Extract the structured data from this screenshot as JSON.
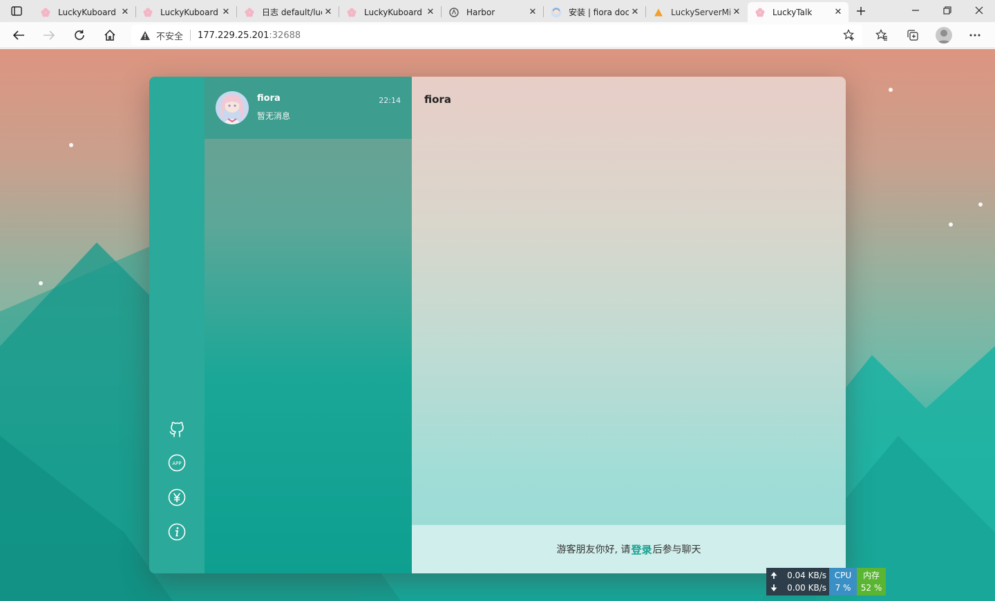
{
  "browser": {
    "tabs": [
      {
        "label": "LuckyKuboard",
        "icon": "sakura-icon"
      },
      {
        "label": "LuckyKuboard",
        "icon": "sakura-icon"
      },
      {
        "label": "日志 default/luc",
        "icon": "sakura-icon"
      },
      {
        "label": "LuckyKuboard",
        "icon": "sakura-icon"
      },
      {
        "label": "Harbor",
        "icon": "harbor-icon"
      },
      {
        "label": "安装 | fiora doc",
        "icon": "anime-avatar-icon"
      },
      {
        "label": "LuckyServerMiy",
        "icon": "warning-triangle-icon"
      },
      {
        "label": "LuckyTalk",
        "icon": "sakura-icon"
      }
    ],
    "active_tab_index": 7,
    "address": {
      "security_label": "不安全",
      "host": "177.229.25.201",
      "port": ":32688"
    }
  },
  "app": {
    "sidebar_icons": [
      "github-icon",
      "app-icon",
      "yen-icon",
      "info-icon"
    ],
    "conversations": [
      {
        "name": "fiora",
        "time": "22:14",
        "preview": "暂无消息"
      }
    ],
    "chat": {
      "title": "fiora",
      "footer_prefix": "游客朋友你好, 请",
      "login_label": "登录",
      "footer_suffix": "后参与聊天"
    },
    "colors": {
      "sidebar": "#2ba99a",
      "accent": "#18a090"
    }
  },
  "net_widget": {
    "upload": "0.04 KB/s",
    "download": "0.00 KB/s",
    "cpu_label": "CPU",
    "cpu_value": "7 %",
    "mem_label": "内存",
    "mem_value": "52 %"
  }
}
